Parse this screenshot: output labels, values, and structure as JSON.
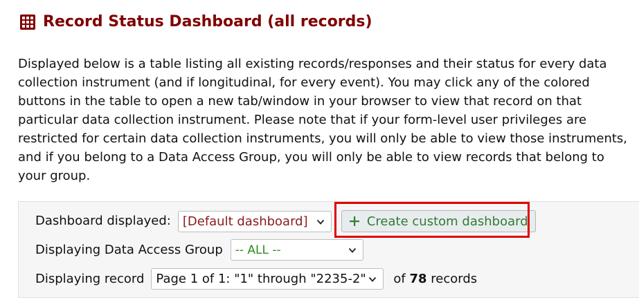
{
  "header": {
    "icon": "table-grid-icon",
    "title": "Record Status Dashboard (all records)"
  },
  "intro": {
    "text": "Displayed below is a table listing all existing records/responses and their status for every data collection instrument (and if longitudinal, for every event). You may click any of the colored buttons in the table to open a new tab/window in your browser to view that record on that particular data collection instrument. Please note that if your form-level user privileges are restricted for certain data collection instruments, you will only be able to view those instruments, and if you belong to a Data Access Group, you will only be able to view records that belong to your group."
  },
  "controls": {
    "dashboard_label": "Dashboard displayed:",
    "dashboard_selected": "[Default dashboard]",
    "create_button_label": "Create custom dashboard",
    "dag_label": "Displaying Data Access Group",
    "dag_selected": "-- ALL --",
    "record_label": "Displaying record",
    "page_selected": "Page 1 of 1: \"1\" through \"2235-2\"",
    "count_prefix": "of",
    "count_value": "78",
    "count_suffix": "records"
  },
  "colors": {
    "title": "#800000",
    "highlight_border": "#e00000",
    "create_button_text": "#2e7d32",
    "dashboard_select_text": "#8b1a1a",
    "dag_select_text": "#2e8b1e"
  }
}
